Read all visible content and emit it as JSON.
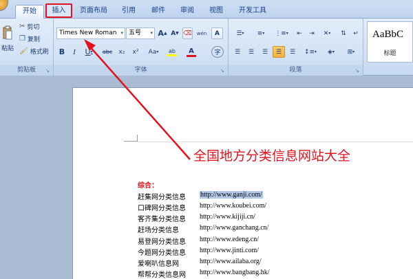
{
  "tabs": [
    {
      "label": "开始",
      "active": true
    },
    {
      "label": "插入",
      "highlighted": true
    },
    {
      "label": "页面布局"
    },
    {
      "label": "引用"
    },
    {
      "label": "邮件"
    },
    {
      "label": "审阅"
    },
    {
      "label": "视图"
    },
    {
      "label": "开发工具"
    }
  ],
  "clipboard": {
    "paste_label": "粘贴",
    "cut_label": "剪切",
    "copy_label": "复制",
    "format_painter_label": "格式刷",
    "group_label": "剪贴板"
  },
  "font": {
    "font_name": "Times New Roman",
    "font_size": "五号",
    "group_label": "字体",
    "grow_glyph": "A",
    "shrink_glyph": "A",
    "phonetic_glyph": "wén",
    "border_glyph": "A",
    "bold_glyph": "B",
    "italic_glyph": "I",
    "underline_glyph": "U",
    "strike_glyph": "abc",
    "subscript_glyph": "x₂",
    "superscript_glyph": "x²",
    "case_glyph": "Aa",
    "highlight_glyph": "ab",
    "color_glyph": "A",
    "circle_glyph": "字"
  },
  "paragraph": {
    "group_label": "段落"
  },
  "styles": {
    "preview": "AaBbC",
    "label": "标题"
  },
  "document": {
    "annotation": "全国地方分类信息网站大全",
    "section_title": "综合：",
    "sites": [
      {
        "name": "赶集网分类信息",
        "url": "http://www.ganji.com/",
        "selected": true
      },
      {
        "name": "口碑网分类信息",
        "url": "http://www.koubei.com/"
      },
      {
        "name": "客齐集分类信息",
        "url": "http://www.kijiji.cn/"
      },
      {
        "name": "赶场分类信息",
        "url": "http://www.ganchang.cn/"
      },
      {
        "name": "易登网分类信息",
        "url": "http://www.edeng.cn/"
      },
      {
        "name": "今题网分类信息",
        "url": "http://www.jinti.com/"
      },
      {
        "name": "爱喇叭信息网",
        "url": "http://www.ailaba.org/"
      },
      {
        "name": "帮帮分类信息网",
        "url": "http://www.bangbang.hk/"
      }
    ]
  },
  "colors": {
    "annotation_red": "#e3111d",
    "ribbon_text": "#15428b",
    "selection": "#b2c8e8"
  }
}
